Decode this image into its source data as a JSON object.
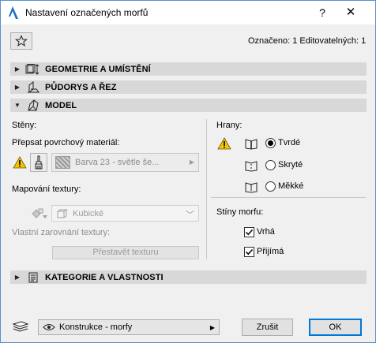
{
  "window": {
    "title": "Nastavení označených morfů",
    "help_label": "?",
    "close_label": "✕"
  },
  "header": {
    "selected_info": "Označeno: 1 Editovatelných: 1"
  },
  "sections": {
    "geometry": "GEOMETRIE A UMÍSTĚNÍ",
    "plan": "PŮDORYS A ŘEZ",
    "model": "MODEL",
    "category": "KATEGORIE A VLASTNOSTI"
  },
  "model": {
    "walls_label": "Stěny:",
    "override_label": "Přepsat povrchový materiál:",
    "material_value": "Barva 23 - světle še...",
    "mapping_label": "Mapování textury:",
    "mapping_value": "Kubické",
    "custom_align_label": "Vlastní zarovnání textury:",
    "rebuild_button": "Přestavět texturu",
    "edges_label": "Hrany:",
    "edges": {
      "hard": "Tvrdé",
      "hidden": "Skryté",
      "soft": "Měkké",
      "selected": "hard"
    },
    "shadows_label": "Stíny morfu:",
    "shadows": {
      "cast": "Vrhá",
      "cast_checked": true,
      "receive": "Přijímá",
      "receive_checked": true
    }
  },
  "footer": {
    "layer_value": "Konstrukce - morfy",
    "cancel_button": "Zrušit",
    "ok_button": "OK"
  },
  "colors": {
    "window_border": "#5a8fc7",
    "section_bg": "#d8d8d8",
    "warning": "#f5c400",
    "default_button": "#0078d7"
  },
  "icons": [
    "archicad-icon",
    "star-icon",
    "geometry-icon",
    "plan-icon",
    "model-icon",
    "category-icon",
    "warning-icon",
    "brush-icon",
    "texture-swatch-icon",
    "mapping-icon",
    "cube-icon",
    "edge-hard-icon",
    "edge-hidden-icon",
    "edge-soft-icon",
    "layer-stack-icon",
    "eye-icon"
  ]
}
